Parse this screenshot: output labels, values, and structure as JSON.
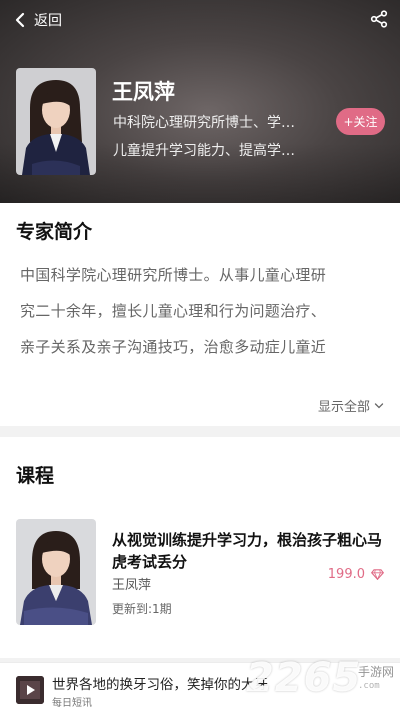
{
  "header": {
    "back_label": "返回",
    "expert_name": "王凤萍",
    "subtitle_line1": "中科院心理研究所博士、学…",
    "subtitle_line2": "儿童提升学习能力、提高学…",
    "follow_label": "+关注",
    "follow_color": "#e06b86"
  },
  "intro": {
    "title": "专家简介",
    "lines": [
      "中国科学院心理研究所博士。从事儿童心理研",
      "究二十余年，擅长儿童心理和行为问题治疗、",
      "亲子关系及亲子沟通技巧，治愈多动症儿童近"
    ],
    "show_all_label": "显示全部"
  },
  "courses": {
    "title": "课程",
    "items": [
      {
        "title": "从视觉训练提升学习力，根治孩子粗心马虎考试丢分",
        "author": "王凤萍",
        "update": "更新到:1期",
        "price": "199.0",
        "price_icon": "diamond-icon"
      }
    ]
  },
  "bottom_bar": {
    "title": "世界各地的换牙习俗，笑掉你的大牙",
    "subtitle": "每日短讯"
  },
  "watermark": {
    "number": "2265",
    "suffix": ".com",
    "label": "手游网"
  }
}
